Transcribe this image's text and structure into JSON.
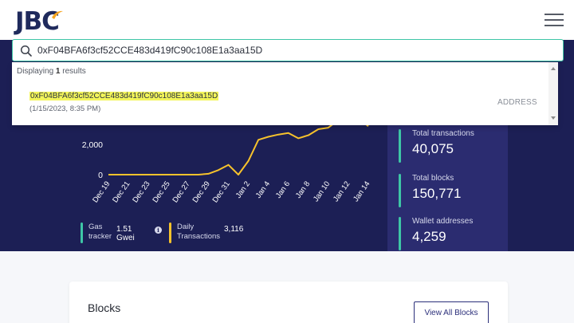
{
  "app": {
    "logo_text": "JBC",
    "menu_icon": "hamburger-icon"
  },
  "search": {
    "value": "0xF04BFA6f3cf52CCE483d419fC90c108E1a3aa15D",
    "icon": "search-icon"
  },
  "dropdown": {
    "count_prefix": "Displaying",
    "count": "1",
    "count_suffix": "results",
    "results": [
      {
        "hash": "0xF04BFA6f3cf52CCE483d419fC90c108E1a3aa15D",
        "timestamp": "(1/15/2023, 8:35 PM)",
        "type": "ADDRESS"
      }
    ]
  },
  "chart": {
    "y_ticks": [
      "2,000",
      "0"
    ],
    "x_ticks": [
      "Dec 19",
      "Dec 21",
      "Dec 23",
      "Dec 25",
      "Dec 27",
      "Dec 29",
      "Dec 31",
      "Jan 2",
      "Jan 4",
      "Jan 6",
      "Jan 8",
      "Jan 10",
      "Jan 12",
      "Jan 14"
    ]
  },
  "chart_data": {
    "type": "line",
    "x": [
      "Dec 19",
      "Dec 20",
      "Dec 21",
      "Dec 22",
      "Dec 23",
      "Dec 24",
      "Dec 25",
      "Dec 26",
      "Dec 27",
      "Dec 28",
      "Dec 29",
      "Dec 30",
      "Dec 31",
      "Jan 1",
      "Jan 2",
      "Jan 3",
      "Jan 4",
      "Jan 5",
      "Jan 6",
      "Jan 7",
      "Jan 8",
      "Jan 9",
      "Jan 10",
      "Jan 11",
      "Jan 12",
      "Jan 13",
      "Jan 14"
    ],
    "series": [
      {
        "values": [
          0,
          0,
          0,
          0,
          0,
          0,
          0,
          0,
          0,
          0,
          60,
          300,
          650,
          0,
          900,
          2300,
          2500,
          2650,
          2750,
          2400,
          2600,
          3000,
          3100,
          3600,
          3450,
          3700,
          3200
        ]
      }
    ],
    "ylim": [
      0,
      3800
    ],
    "y_ticks": [
      0,
      2000
    ],
    "color": "#f6c22c"
  },
  "ticker": {
    "gas_label": "Gas tracker",
    "gas_value": "1.51 Gwei",
    "daily_label": "Daily Transactions",
    "daily_value": "3,116",
    "gas_color": "#3ec6a6",
    "daily_color": "#f6c22c"
  },
  "stats": [
    {
      "label": "Total transactions",
      "value": "40,075"
    },
    {
      "label": "Total blocks",
      "value": "150,771"
    },
    {
      "label": "Wallet addresses",
      "value": "4,259"
    }
  ],
  "blocks": {
    "title": "Blocks",
    "view_all": "View All Blocks"
  }
}
